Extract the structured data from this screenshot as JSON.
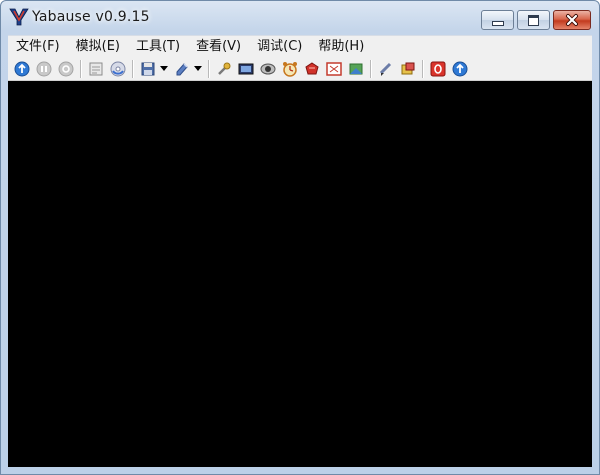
{
  "window": {
    "title": "Yabause v0.9.15",
    "app_icon": "yabause-logo-icon",
    "controls": [
      "minimize-icon",
      "maximize-icon",
      "close-icon"
    ]
  },
  "menu": {
    "items": [
      {
        "id": "file",
        "label": "文件(F)"
      },
      {
        "id": "emulation",
        "label": "模拟(E)"
      },
      {
        "id": "tools",
        "label": "工具(T)"
      },
      {
        "id": "view",
        "label": "查看(V)"
      },
      {
        "id": "debug",
        "label": "调试(C)"
      },
      {
        "id": "help",
        "label": "帮助(H)"
      }
    ]
  },
  "toolbar": {
    "icons": [
      "run-icon",
      "pause-icon",
      "reset-icon",
      "open-iso-icon",
      "open-cd-icon",
      "save-state-icon",
      "load-state-icon",
      "settings-icon",
      "screenshot-icon",
      "frame-skip-icon",
      "fps-icon",
      "cheats-icon",
      "fullscreen-icon",
      "layer-icon",
      "sound-icon",
      "memory-icon",
      "power-icon",
      "about-icon"
    ]
  },
  "colors": {
    "screen": "#000000",
    "close_button": "#c23a1e",
    "accent_blue": "#2f79d4"
  }
}
